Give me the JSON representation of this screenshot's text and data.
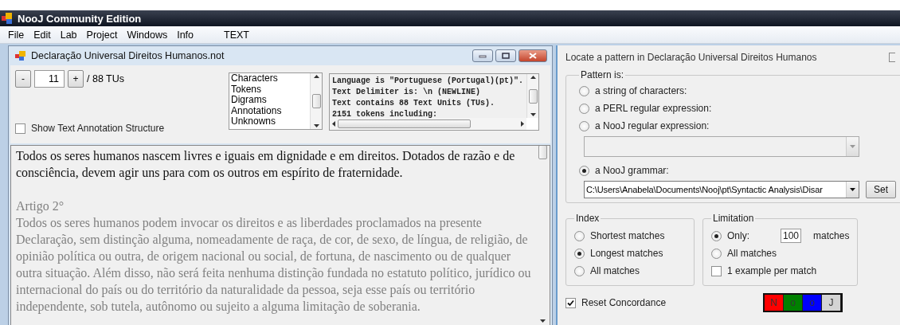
{
  "app": {
    "title": "NooJ Community Edition"
  },
  "menu": [
    "File",
    "Edit",
    "Lab",
    "Project",
    "Windows",
    "Info",
    "TEXT"
  ],
  "text_window": {
    "title": "Declaração Universal Direitos Humanos.not",
    "minus": "-",
    "unit": "11",
    "plus": "+",
    "total": "/ 88 TUs",
    "show_annotation": {
      "label": "Show Text Annotation Structure",
      "checked": false
    },
    "views": [
      "Characters",
      "Tokens",
      "Digrams",
      "Annotations",
      "Unknowns"
    ],
    "info_lines": [
      "Language is \"Portuguese (Portugal)(pt)\".",
      "Text Delimiter is: \\n (NEWLINE)",
      "Text contains 88 Text Units (TUs).",
      "2151 tokens including:"
    ],
    "text_units": [
      {
        "body": "Todos os seres humanos nascem livres e iguais em dignidade e em direitos. Dotados de razão e de consciência, devem agir uns para com os outros em espírito de fraternidade.",
        "selected": true
      },
      {
        "heading": "Artigo 2°",
        "body": "Todos os seres humanos podem invocar os direitos e as liberdades proclamados na presente Declaração, sem distinção alguma, nomeadamente de raça, de cor, de sexo, de língua, de religião, de opinião política ou outra, de origem nacional ou social, de fortuna, de nascimento ou de qualquer outra situação. Além disso, não será feita nenhuma distinção fundada no estatuto político, jurídico ou internacional do país ou do território da naturalidade da pessoa, seja esse país ou território independente, sob tutela, autônomo ou sujeito a alguma limitação de soberania.",
        "selected": false
      }
    ]
  },
  "locate": {
    "title": "Locate a pattern in Declaração Universal Direitos Humanos",
    "pattern": {
      "legend": "Pattern is:",
      "options": [
        {
          "label": "a string of characters:",
          "selected": false
        },
        {
          "label": "a PERL regular expression:",
          "selected": false
        },
        {
          "label": "a NooJ regular expression:",
          "selected": false
        },
        {
          "label": "a NooJ grammar:",
          "selected": true
        }
      ],
      "regex_field": {
        "disabled": true
      },
      "grammar_path": "C:\\Users\\Anabela\\Documents\\Nooj\\pt\\Syntactic Analysis\\Disar",
      "set": "Set"
    },
    "index": {
      "legend": "Index",
      "options": [
        {
          "label": "Shortest matches",
          "selected": false
        },
        {
          "label": "Longest matches",
          "selected": true
        },
        {
          "label": "All matches",
          "selected": false
        }
      ]
    },
    "limitation": {
      "legend": "Limitation",
      "options": [
        {
          "label": "Only:",
          "selected": true,
          "value": "100",
          "unit": "matches"
        },
        {
          "label": "All matches",
          "selected": false
        }
      ],
      "one_example": {
        "label": "1 example per match",
        "checked": false
      }
    },
    "reset": {
      "label": "Reset Concordance",
      "checked": true
    },
    "logo": [
      {
        "letter": "N",
        "color": "#ff0000"
      },
      {
        "letter": "o",
        "color": "#008000"
      },
      {
        "letter": "o",
        "color": "#0000ff"
      },
      {
        "letter": "J",
        "color": "#d4d4d4"
      }
    ]
  }
}
